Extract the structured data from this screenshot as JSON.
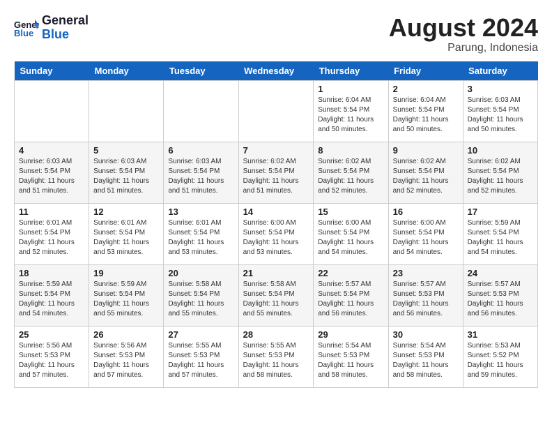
{
  "logo": {
    "line1": "General",
    "line2": "Blue"
  },
  "title": "August 2024",
  "location": "Parung, Indonesia",
  "days_of_week": [
    "Sunday",
    "Monday",
    "Tuesday",
    "Wednesday",
    "Thursday",
    "Friday",
    "Saturday"
  ],
  "weeks": [
    [
      {
        "day": "",
        "sunrise": "",
        "sunset": "",
        "daylight": ""
      },
      {
        "day": "",
        "sunrise": "",
        "sunset": "",
        "daylight": ""
      },
      {
        "day": "",
        "sunrise": "",
        "sunset": "",
        "daylight": ""
      },
      {
        "day": "",
        "sunrise": "",
        "sunset": "",
        "daylight": ""
      },
      {
        "day": "1",
        "sunrise": "Sunrise: 6:04 AM",
        "sunset": "Sunset: 5:54 PM",
        "daylight": "Daylight: 11 hours and 50 minutes."
      },
      {
        "day": "2",
        "sunrise": "Sunrise: 6:04 AM",
        "sunset": "Sunset: 5:54 PM",
        "daylight": "Daylight: 11 hours and 50 minutes."
      },
      {
        "day": "3",
        "sunrise": "Sunrise: 6:03 AM",
        "sunset": "Sunset: 5:54 PM",
        "daylight": "Daylight: 11 hours and 50 minutes."
      }
    ],
    [
      {
        "day": "4",
        "sunrise": "Sunrise: 6:03 AM",
        "sunset": "Sunset: 5:54 PM",
        "daylight": "Daylight: 11 hours and 51 minutes."
      },
      {
        "day": "5",
        "sunrise": "Sunrise: 6:03 AM",
        "sunset": "Sunset: 5:54 PM",
        "daylight": "Daylight: 11 hours and 51 minutes."
      },
      {
        "day": "6",
        "sunrise": "Sunrise: 6:03 AM",
        "sunset": "Sunset: 5:54 PM",
        "daylight": "Daylight: 11 hours and 51 minutes."
      },
      {
        "day": "7",
        "sunrise": "Sunrise: 6:02 AM",
        "sunset": "Sunset: 5:54 PM",
        "daylight": "Daylight: 11 hours and 51 minutes."
      },
      {
        "day": "8",
        "sunrise": "Sunrise: 6:02 AM",
        "sunset": "Sunset: 5:54 PM",
        "daylight": "Daylight: 11 hours and 52 minutes."
      },
      {
        "day": "9",
        "sunrise": "Sunrise: 6:02 AM",
        "sunset": "Sunset: 5:54 PM",
        "daylight": "Daylight: 11 hours and 52 minutes."
      },
      {
        "day": "10",
        "sunrise": "Sunrise: 6:02 AM",
        "sunset": "Sunset: 5:54 PM",
        "daylight": "Daylight: 11 hours and 52 minutes."
      }
    ],
    [
      {
        "day": "11",
        "sunrise": "Sunrise: 6:01 AM",
        "sunset": "Sunset: 5:54 PM",
        "daylight": "Daylight: 11 hours and 52 minutes."
      },
      {
        "day": "12",
        "sunrise": "Sunrise: 6:01 AM",
        "sunset": "Sunset: 5:54 PM",
        "daylight": "Daylight: 11 hours and 53 minutes."
      },
      {
        "day": "13",
        "sunrise": "Sunrise: 6:01 AM",
        "sunset": "Sunset: 5:54 PM",
        "daylight": "Daylight: 11 hours and 53 minutes."
      },
      {
        "day": "14",
        "sunrise": "Sunrise: 6:00 AM",
        "sunset": "Sunset: 5:54 PM",
        "daylight": "Daylight: 11 hours and 53 minutes."
      },
      {
        "day": "15",
        "sunrise": "Sunrise: 6:00 AM",
        "sunset": "Sunset: 5:54 PM",
        "daylight": "Daylight: 11 hours and 54 minutes."
      },
      {
        "day": "16",
        "sunrise": "Sunrise: 6:00 AM",
        "sunset": "Sunset: 5:54 PM",
        "daylight": "Daylight: 11 hours and 54 minutes."
      },
      {
        "day": "17",
        "sunrise": "Sunrise: 5:59 AM",
        "sunset": "Sunset: 5:54 PM",
        "daylight": "Daylight: 11 hours and 54 minutes."
      }
    ],
    [
      {
        "day": "18",
        "sunrise": "Sunrise: 5:59 AM",
        "sunset": "Sunset: 5:54 PM",
        "daylight": "Daylight: 11 hours and 54 minutes."
      },
      {
        "day": "19",
        "sunrise": "Sunrise: 5:59 AM",
        "sunset": "Sunset: 5:54 PM",
        "daylight": "Daylight: 11 hours and 55 minutes."
      },
      {
        "day": "20",
        "sunrise": "Sunrise: 5:58 AM",
        "sunset": "Sunset: 5:54 PM",
        "daylight": "Daylight: 11 hours and 55 minutes."
      },
      {
        "day": "21",
        "sunrise": "Sunrise: 5:58 AM",
        "sunset": "Sunset: 5:54 PM",
        "daylight": "Daylight: 11 hours and 55 minutes."
      },
      {
        "day": "22",
        "sunrise": "Sunrise: 5:57 AM",
        "sunset": "Sunset: 5:54 PM",
        "daylight": "Daylight: 11 hours and 56 minutes."
      },
      {
        "day": "23",
        "sunrise": "Sunrise: 5:57 AM",
        "sunset": "Sunset: 5:53 PM",
        "daylight": "Daylight: 11 hours and 56 minutes."
      },
      {
        "day": "24",
        "sunrise": "Sunrise: 5:57 AM",
        "sunset": "Sunset: 5:53 PM",
        "daylight": "Daylight: 11 hours and 56 minutes."
      }
    ],
    [
      {
        "day": "25",
        "sunrise": "Sunrise: 5:56 AM",
        "sunset": "Sunset: 5:53 PM",
        "daylight": "Daylight: 11 hours and 57 minutes."
      },
      {
        "day": "26",
        "sunrise": "Sunrise: 5:56 AM",
        "sunset": "Sunset: 5:53 PM",
        "daylight": "Daylight: 11 hours and 57 minutes."
      },
      {
        "day": "27",
        "sunrise": "Sunrise: 5:55 AM",
        "sunset": "Sunset: 5:53 PM",
        "daylight": "Daylight: 11 hours and 57 minutes."
      },
      {
        "day": "28",
        "sunrise": "Sunrise: 5:55 AM",
        "sunset": "Sunset: 5:53 PM",
        "daylight": "Daylight: 11 hours and 58 minutes."
      },
      {
        "day": "29",
        "sunrise": "Sunrise: 5:54 AM",
        "sunset": "Sunset: 5:53 PM",
        "daylight": "Daylight: 11 hours and 58 minutes."
      },
      {
        "day": "30",
        "sunrise": "Sunrise: 5:54 AM",
        "sunset": "Sunset: 5:53 PM",
        "daylight": "Daylight: 11 hours and 58 minutes."
      },
      {
        "day": "31",
        "sunrise": "Sunrise: 5:53 AM",
        "sunset": "Sunset: 5:52 PM",
        "daylight": "Daylight: 11 hours and 59 minutes."
      }
    ]
  ]
}
